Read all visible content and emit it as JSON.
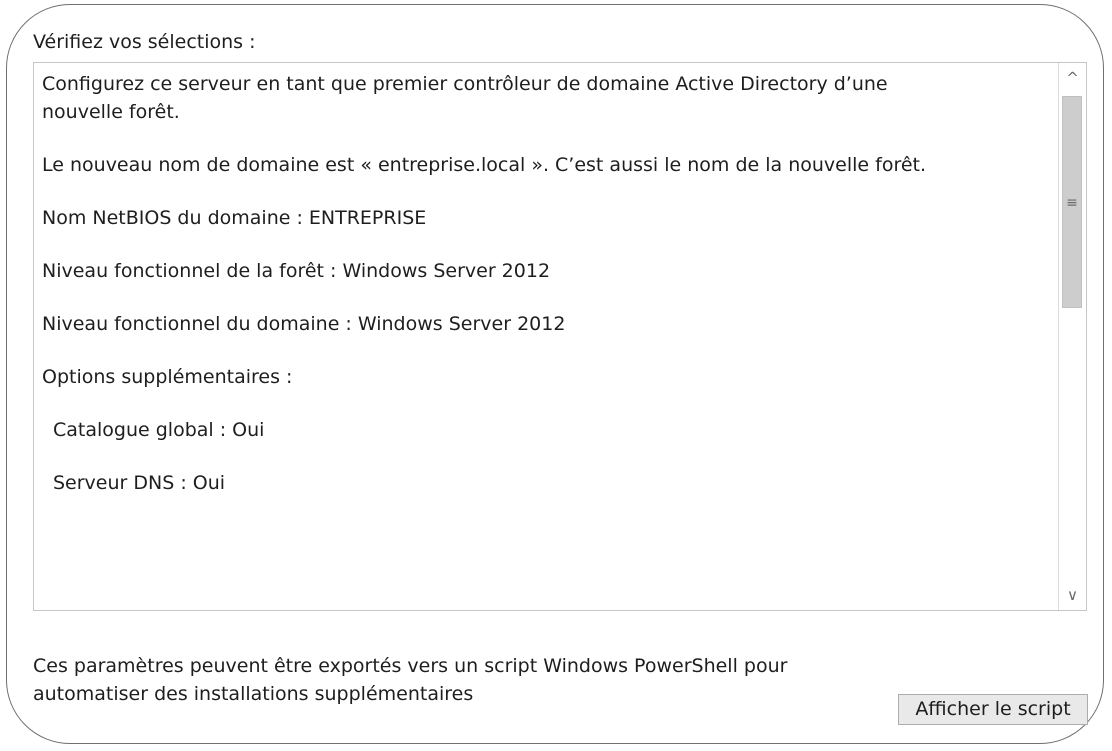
{
  "heading": "Vérifiez vos sélections :",
  "summary": {
    "lines": [
      "Configurez ce serveur en tant que premier contrôleur de domaine Active Directory d’une",
      "nouvelle forêt.",
      "Le nouveau nom de domaine est « entreprise.local ». C’est aussi le nom de la nouvelle forêt.",
      "Nom NetBIOS du domaine : ENTREPRISE",
      "Niveau fonctionnel de la forêt : Windows Server 2012",
      "Niveau fonctionnel du domaine : Windows Server 2012",
      "Options supplémentaires :",
      "Catalogue global : Oui",
      "Serveur DNS : Oui"
    ]
  },
  "scrollbar": {
    "up_arrow": "^",
    "grip": "≡",
    "down_arrow": "∨",
    "thumb_fraction": 0.44
  },
  "export": {
    "line1": "Ces paramètres peuvent être exportés vers un script Windows PowerShell pour",
    "line2": "automatiser des installations supplémentaires",
    "button_label": "Afficher le script"
  }
}
